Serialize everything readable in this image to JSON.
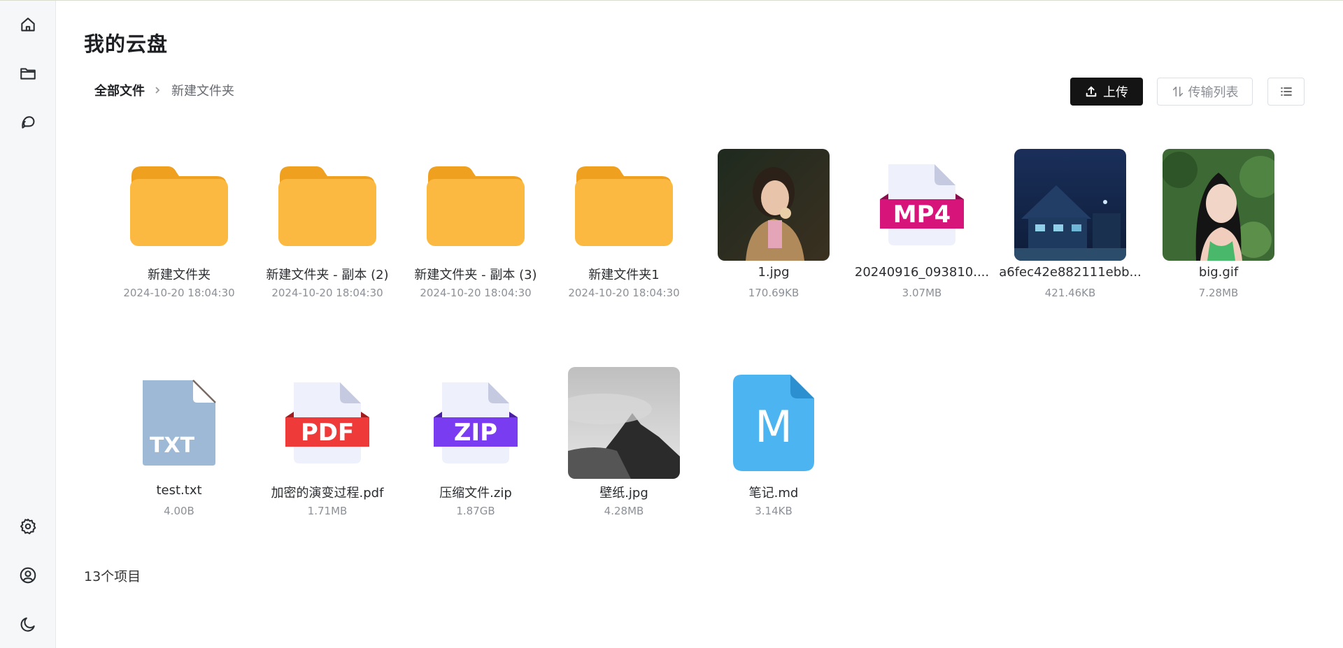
{
  "app": {
    "title": "我的云盘"
  },
  "sidebar": {
    "items": [
      {
        "name": "home-icon"
      },
      {
        "name": "folder-icon"
      },
      {
        "name": "chat-icon"
      },
      {
        "name": "settings-icon"
      },
      {
        "name": "user-icon"
      },
      {
        "name": "moon-icon"
      }
    ]
  },
  "breadcrumb": {
    "root": "全部文件",
    "current": "新建文件夹"
  },
  "toolbar": {
    "upload_label": "上传",
    "transfer_label": "传输列表"
  },
  "files": [
    {
      "name": "新建文件夹",
      "meta": "2024-10-20 18:04:30",
      "kind": "folder"
    },
    {
      "name": "新建文件夹 - 副本 (2)",
      "meta": "2024-10-20 18:04:30",
      "kind": "folder"
    },
    {
      "name": "新建文件夹 - 副本 (3)",
      "meta": "2024-10-20 18:04:30",
      "kind": "folder"
    },
    {
      "name": "新建文件夹1",
      "meta": "2024-10-20 18:04:30",
      "kind": "folder"
    },
    {
      "name": "1.jpg",
      "meta": "170.69KB",
      "kind": "image"
    },
    {
      "name": "20240916_093810....",
      "meta": "3.07MB",
      "kind": "mp4",
      "badge": "MP4"
    },
    {
      "name": "a6fec42e882111ebb...",
      "meta": "421.46KB",
      "kind": "image"
    },
    {
      "name": "big.gif",
      "meta": "7.28MB",
      "kind": "image"
    },
    {
      "name": "test.txt",
      "meta": "4.00B",
      "kind": "txt",
      "badge": "TXT"
    },
    {
      "name": "加密的演变过程.pdf",
      "meta": "1.71MB",
      "kind": "pdf",
      "badge": "PDF"
    },
    {
      "name": "压缩文件.zip",
      "meta": "1.87GB",
      "kind": "zip",
      "badge": "ZIP"
    },
    {
      "name": "壁纸.jpg",
      "meta": "4.28MB",
      "kind": "image"
    },
    {
      "name": "笔记.md",
      "meta": "3.14KB",
      "kind": "md",
      "badge": "M"
    }
  ],
  "footer": {
    "count": "13个项目"
  },
  "colors": {
    "folder": "#fbb942",
    "folder_tab": "#f0a01f",
    "mp4_band": "#d6147a",
    "pdf_band": "#ef3a3a",
    "zip_band": "#7a3cf0",
    "txt_body": "#9db9d6",
    "md_body": "#4db4f2"
  }
}
